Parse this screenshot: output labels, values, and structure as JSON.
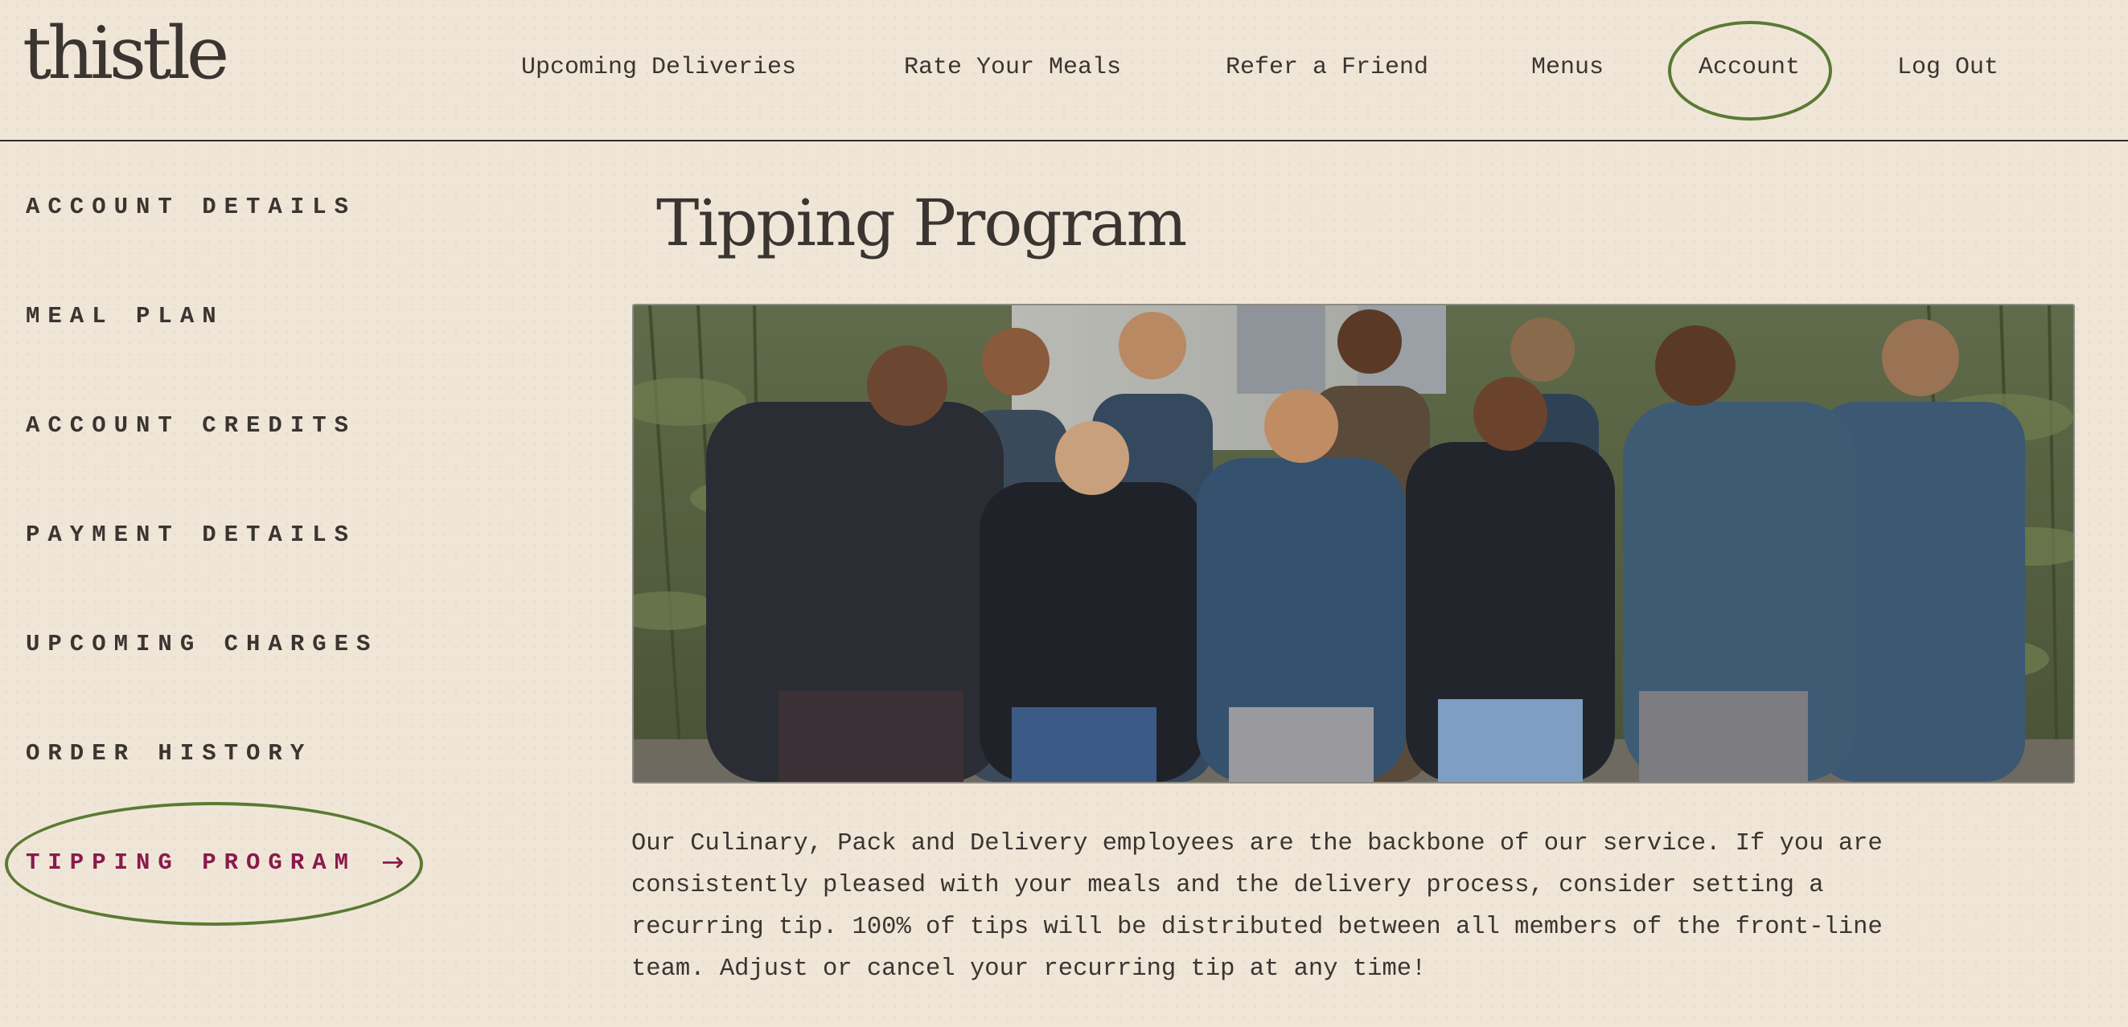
{
  "brand": {
    "logo_text": "thistle"
  },
  "nav": {
    "items": [
      {
        "label": "Upcoming Deliveries"
      },
      {
        "label": "Rate Your Meals"
      },
      {
        "label": "Refer a Friend"
      },
      {
        "label": "Menus"
      },
      {
        "label": "Account",
        "highlighted": true
      },
      {
        "label": "Log Out"
      }
    ]
  },
  "sidebar": {
    "items": [
      {
        "label": "ACCOUNT DETAILS"
      },
      {
        "label": "MEAL PLAN"
      },
      {
        "label": "ACCOUNT CREDITS"
      },
      {
        "label": "PAYMENT DETAILS"
      },
      {
        "label": "UPCOMING CHARGES"
      },
      {
        "label": "ORDER HISTORY"
      },
      {
        "label": "TIPPING PROGRAM",
        "active": true,
        "icon": "arrow-right-icon"
      }
    ]
  },
  "main": {
    "title": "Tipping Program",
    "photo": {
      "subject": "team-group-photo"
    },
    "description": "Our Culinary, Pack and Delivery employees are the backbone of our service. If you are consistently pleased with your meals and the delivery process, consider setting a recurring tip. 100% of tips will be distributed between all members of the front-line team. Adjust or cancel your recurring tip at any time!"
  },
  "colors": {
    "background": "#efe6d8",
    "text": "#3a3530",
    "active_accent": "#8a1a4a",
    "highlight_ring": "#5a7a32"
  }
}
